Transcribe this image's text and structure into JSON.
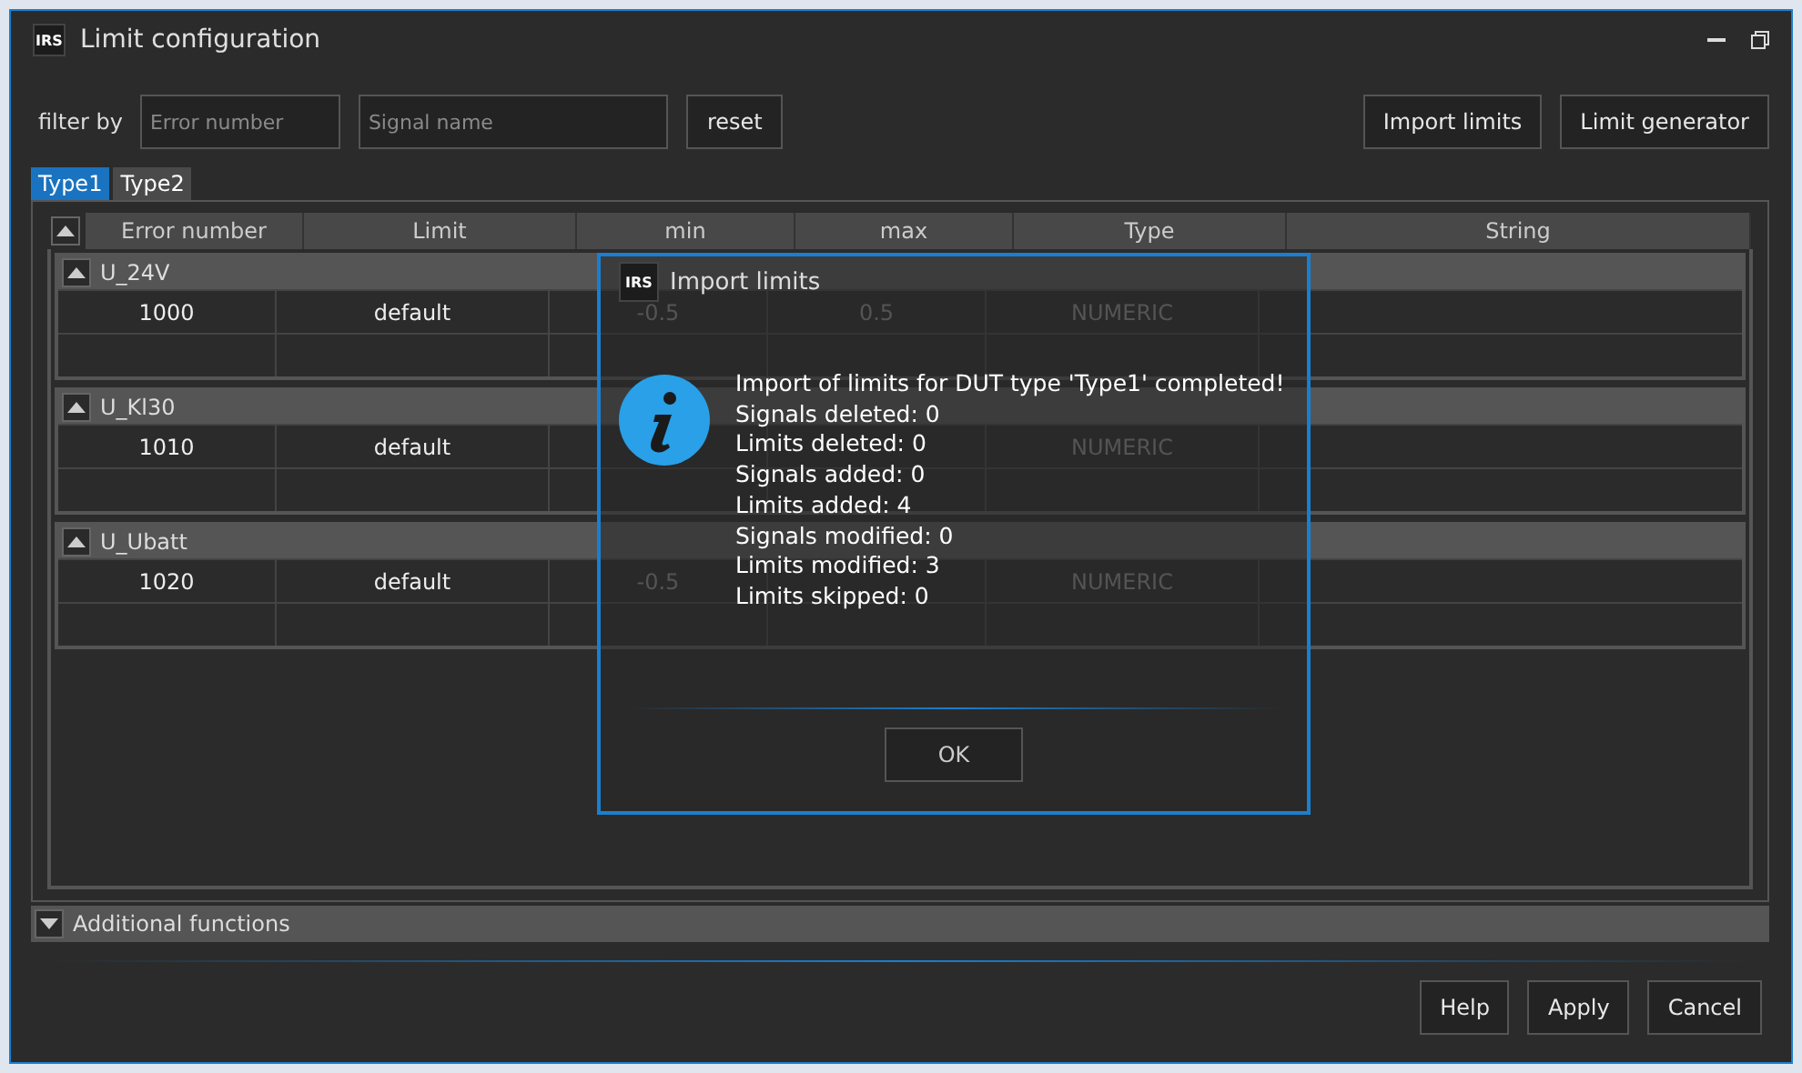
{
  "window": {
    "title": "Limit configuration",
    "logo": "IRS"
  },
  "filter": {
    "label": "filter by",
    "fields": [
      {
        "placeholder": "Error number"
      },
      {
        "placeholder": "Signal name"
      }
    ],
    "reset": "reset"
  },
  "toolbar_buttons": [
    "Import limits",
    "Limit generator"
  ],
  "tabs": [
    {
      "label": "Type1",
      "selected": true
    },
    {
      "label": "Type2",
      "selected": false
    }
  ],
  "table": {
    "columns": [
      "Error number",
      "Limit",
      "min",
      "max",
      "Type",
      "String"
    ],
    "groups": [
      {
        "name": "U_24V",
        "expanded": true,
        "rows": [
          {
            "error_number": "1000",
            "limit": "default",
            "min": "-0.5",
            "max": "0.5",
            "type": "NUMERIC"
          }
        ]
      },
      {
        "name": "U_Kl30",
        "expanded": true,
        "rows": [
          {
            "error_number": "1010",
            "limit": "default",
            "type": "NUMERIC"
          }
        ]
      },
      {
        "name": "U_Ubatt",
        "expanded": true,
        "rows": [
          {
            "error_number": "1020",
            "limit": "default",
            "min": "-0.5",
            "type": "NUMERIC"
          }
        ]
      }
    ]
  },
  "additional_functions": {
    "label": "Additional functions",
    "expanded": false
  },
  "footer_buttons": [
    "Help",
    "Apply",
    "Cancel"
  ],
  "dialog": {
    "title": "Import limits",
    "logo": "IRS",
    "lines": [
      "Import of limits for DUT type 'Type1' completed!",
      "Signals deleted: 0",
      "Limits deleted: 0",
      "Signals added: 0",
      "Limits added: 4",
      "Signals modified: 0",
      "Limits modified: 3",
      "Limits skipped: 0"
    ],
    "button": "OK"
  }
}
